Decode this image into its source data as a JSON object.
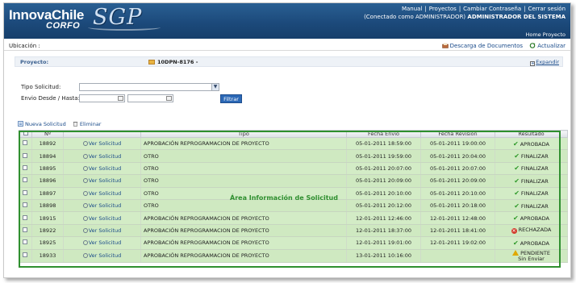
{
  "header": {
    "logo_innova": "InnovaChile",
    "logo_corfo": "CORFO",
    "logo_sgp": "SGP",
    "links": [
      "Manual",
      "Proyectos",
      "Cambiar Contraseña",
      "Cerrar sesión"
    ],
    "connected_prefix": "(Conectado como ADMINISTRADOR)",
    "connected_user": "ADMINISTRADOR DEL SISTEMA",
    "home_link": "Home Proyecto"
  },
  "ubicacion": {
    "label": "Ubicación :",
    "download_label": "Descarga de Documentos",
    "refresh_label": "Actualizar"
  },
  "proyecto": {
    "label": "Proyecto:",
    "value": "10DPN-8176 -",
    "expand_label": "Expandir"
  },
  "filters": {
    "tipo_label": "Tipo Solicitud:",
    "tipo_value": "",
    "envio_label": "Envio Desde / Hasta:",
    "desde_value": "",
    "hasta_value": "",
    "filter_button": "Filtrar"
  },
  "toolbar": {
    "new_label": "Nueva Solicitud",
    "delete_label": "Eliminar"
  },
  "table": {
    "columns": [
      "Nº",
      "",
      "Tipo",
      "Fecha Envio",
      "Fecha Revision",
      "Resultado"
    ],
    "view_label": "Ver Solicitud",
    "rows": [
      {
        "n": "18892",
        "tipo": "APROBACIÓN REPROGRAMACION DE PROYECTO",
        "envio": "05-01-2011 18:59:00",
        "revision": "05-01-2011 19:00:00",
        "resultado": "APROBADA",
        "status": "ok"
      },
      {
        "n": "18894",
        "tipo": "OTRO",
        "envio": "05-01-2011 19:59:00",
        "revision": "05-01-2011 20:04:00",
        "resultado": "FINALIZAR",
        "status": "ok"
      },
      {
        "n": "18895",
        "tipo": "OTRO",
        "envio": "05-01-2011 20:07:00",
        "revision": "05-01-2011 20:07:00",
        "resultado": "FINALIZAR",
        "status": "ok"
      },
      {
        "n": "18896",
        "tipo": "OTRO",
        "envio": "05-01-2011 20:09:00",
        "revision": "05-01-2011 20:09:00",
        "resultado": "FINALIZAR",
        "status": "ok"
      },
      {
        "n": "18897",
        "tipo": "OTRO",
        "envio": "05-01-2011 20:10:00",
        "revision": "05-01-2011 20:10:00",
        "resultado": "FINALIZAR",
        "status": "ok"
      },
      {
        "n": "18898",
        "tipo": "OTRO",
        "envio": "05-01-2011 20:12:00",
        "revision": "05-01-2011 20:18:00",
        "resultado": "FINALIZAR",
        "status": "ok"
      },
      {
        "n": "18915",
        "tipo": "APROBACIÓN REPROGRAMACION DE PROYECTO",
        "envio": "12-01-2011 12:46:00",
        "revision": "12-01-2011 12:48:00",
        "resultado": "APROBADA",
        "status": "ok"
      },
      {
        "n": "18922",
        "tipo": "APROBACIÓN REPROGRAMACION DE PROYECTO",
        "envio": "12-01-2011 18:37:00",
        "revision": "12-01-2011 18:41:00",
        "resultado": "RECHAZADA",
        "status": "rejected"
      },
      {
        "n": "18925",
        "tipo": "APROBACIÓN REPROGRAMACION DE PROYECTO",
        "envio": "12-01-2011 19:01:00",
        "revision": "12-01-2011 19:02:00",
        "resultado": "APROBADA",
        "status": "ok"
      },
      {
        "n": "18933",
        "tipo": "APROBACIÓN REPROGRAMACION DE PROYECTO",
        "envio": "13-01-2011 10:16:00",
        "revision": "",
        "resultado": "PENDIENTE",
        "resultado2": "Sin Enviar",
        "status": "pending"
      }
    ]
  },
  "overlay_label": "Área Información de Solicitud",
  "colors": {
    "header_bg": "#1c4a7b",
    "row_bg": "#d3ecc6",
    "highlight_border": "#2f8f2f",
    "link": "#1a4b8a"
  }
}
